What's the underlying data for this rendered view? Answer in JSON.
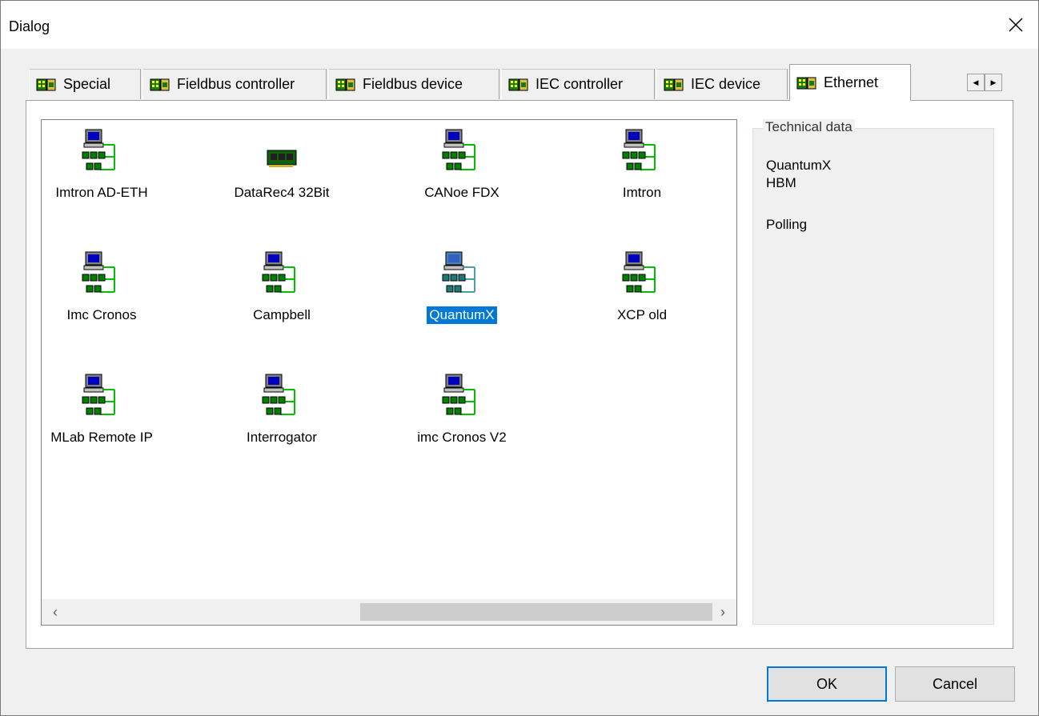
{
  "window": {
    "title": "Dialog"
  },
  "tabs": [
    {
      "label": "Special",
      "active": false
    },
    {
      "label": "Fieldbus controller",
      "active": false
    },
    {
      "label": "Fieldbus device",
      "active": false
    },
    {
      "label": "IEC controller",
      "active": false
    },
    {
      "label": "IEC device",
      "active": false
    },
    {
      "label": "Ethernet",
      "active": true
    }
  ],
  "devices": [
    {
      "label": "Imtron AD-ETH",
      "icon": "network-device-icon",
      "selected": false
    },
    {
      "label": "DataRec4 32Bit",
      "icon": "pci-card-icon",
      "selected": false
    },
    {
      "label": "CANoe FDX",
      "icon": "network-device-icon",
      "selected": false
    },
    {
      "label": "Imtron",
      "icon": "network-device-icon",
      "selected": false
    },
    {
      "label": "Imc Cronos",
      "icon": "network-device-icon",
      "selected": false
    },
    {
      "label": "Campbell",
      "icon": "network-device-icon",
      "selected": false
    },
    {
      "label": "QuantumX",
      "icon": "network-device-icon",
      "selected": true
    },
    {
      "label": "XCP old",
      "icon": "network-device-icon",
      "selected": false
    },
    {
      "label": "MLab Remote IP",
      "icon": "network-device-icon",
      "selected": false
    },
    {
      "label": "Interrogator",
      "icon": "network-device-icon",
      "selected": false
    },
    {
      "label": "imc Cronos V2",
      "icon": "network-device-icon",
      "selected": false
    }
  ],
  "technical_data": {
    "title": "Technical data",
    "lines": [
      "QuantumX",
      "HBM",
      "",
      "Polling"
    ]
  },
  "buttons": {
    "ok": "OK",
    "cancel": "Cancel"
  },
  "colors": {
    "selection": "#0078d7",
    "icon_green": "#008000",
    "icon_blue": "#0000c0"
  }
}
